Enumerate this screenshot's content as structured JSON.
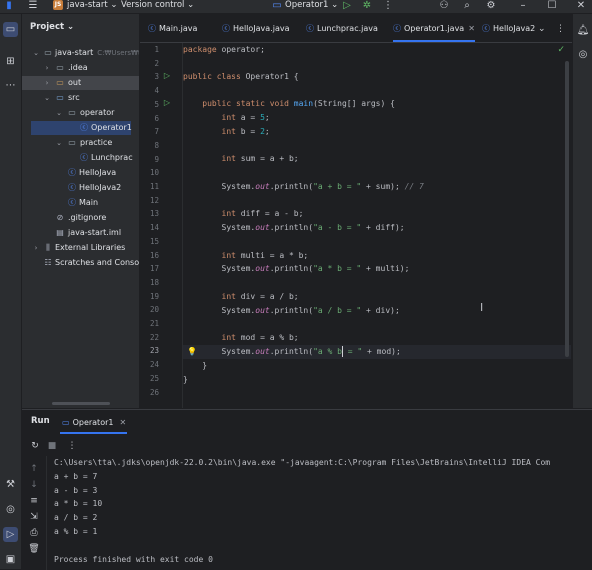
{
  "titlebar": {
    "project_badge": "JS",
    "project_name": "java-start",
    "vcs": "Version control",
    "run_config": "Operator1"
  },
  "project_panel": {
    "title": "Project",
    "tree": [
      {
        "label": "java-start",
        "sub": "C:₩Users₩tta",
        "type": "folder"
      },
      {
        "label": ".idea",
        "type": "folder"
      },
      {
        "label": "out",
        "type": "folder"
      },
      {
        "label": "src",
        "type": "folder"
      },
      {
        "label": "operator",
        "type": "folder"
      },
      {
        "label": "Operator1",
        "type": "class"
      },
      {
        "label": "practice",
        "type": "folder"
      },
      {
        "label": "Lunchprac",
        "type": "class"
      },
      {
        "label": "HelloJava",
        "type": "class"
      },
      {
        "label": "HelloJava2",
        "type": "class"
      },
      {
        "label": "Main",
        "type": "class"
      },
      {
        "label": ".gitignore",
        "type": "file"
      },
      {
        "label": "java-start.iml",
        "type": "file"
      },
      {
        "label": "External Libraries",
        "type": "lib"
      },
      {
        "label": "Scratches and Consoles",
        "type": "scratch"
      }
    ]
  },
  "tabs": [
    {
      "label": "Main.java"
    },
    {
      "label": "HelloJava.java"
    },
    {
      "label": "Lunchprac.java"
    },
    {
      "label": "Operator1.java",
      "active": true
    },
    {
      "label": "HelloJava2"
    }
  ],
  "editor": {
    "line_numbers": [
      "1",
      "2",
      "3",
      "4",
      "5",
      "6",
      "7",
      "8",
      "9",
      "10",
      "11",
      "12",
      "13",
      "14",
      "15",
      "16",
      "17",
      "18",
      "19",
      "20",
      "21",
      "22",
      "23",
      "24",
      "25",
      "26"
    ],
    "current_line": "23"
  },
  "run_panel": {
    "title": "Run",
    "tab": "Operator1",
    "console": [
      "C:\\Users\\tta\\.jdks\\openjdk-22.0.2\\bin\\java.exe \"-javaagent:C:\\Program Files\\JetBrains\\IntelliJ IDEA Com",
      "a + b = 7",
      "a - b = 3",
      "a * b = 10",
      "a / b = 2",
      "a % b = 1",
      "",
      "Process finished with exit code 0"
    ]
  }
}
